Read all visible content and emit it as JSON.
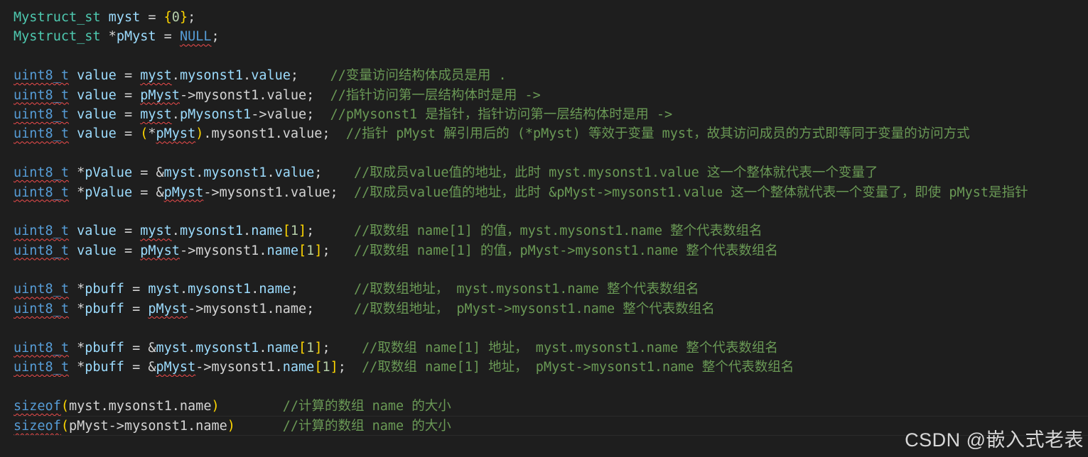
{
  "editor": {
    "lines": [
      [
        {
          "t": "Mystruct_st",
          "c": "t-type"
        },
        {
          "t": " "
        },
        {
          "t": "myst",
          "c": "t-var"
        },
        {
          "t": " = "
        },
        {
          "t": "{",
          "c": "t-brace"
        },
        {
          "t": "0",
          "c": "t-num"
        },
        {
          "t": "}",
          "c": "t-brace"
        },
        {
          "t": ";"
        }
      ],
      [
        {
          "t": "Mystruct_st",
          "c": "t-type"
        },
        {
          "t": " *"
        },
        {
          "t": "pMyst",
          "c": "t-var"
        },
        {
          "t": " = "
        },
        {
          "t": "NULL",
          "c": "t-kw squig"
        },
        {
          "t": ";"
        }
      ],
      [],
      [
        {
          "t": "uint8_t",
          "c": "t-kw squig"
        },
        {
          "t": " "
        },
        {
          "t": "value",
          "c": "t-var"
        },
        {
          "t": " = "
        },
        {
          "t": "myst",
          "c": "t-var squig"
        },
        {
          "t": "."
        },
        {
          "t": "mysonst1",
          "c": "t-var"
        },
        {
          "t": "."
        },
        {
          "t": "value",
          "c": "t-var"
        },
        {
          "t": ";    "
        },
        {
          "t": "//变量访问结构体成员是用 .",
          "c": "t-cmt"
        }
      ],
      [
        {
          "t": "uint8_t",
          "c": "t-kw squig"
        },
        {
          "t": " "
        },
        {
          "t": "value",
          "c": "t-var"
        },
        {
          "t": " = "
        },
        {
          "t": "pMyst",
          "c": "t-var squig"
        },
        {
          "t": "->mysonst1.value;  "
        },
        {
          "t": "//指针访问第一层结构体时是用 ->",
          "c": "t-cmt"
        }
      ],
      [
        {
          "t": "uint8_t",
          "c": "t-kw squig"
        },
        {
          "t": " "
        },
        {
          "t": "value",
          "c": "t-var"
        },
        {
          "t": " = "
        },
        {
          "t": "myst",
          "c": "t-var squig"
        },
        {
          "t": "."
        },
        {
          "t": "pMysonst1",
          "c": "t-var"
        },
        {
          "t": "->value;  "
        },
        {
          "t": "//pMysonst1 是指针，指针访问第一层结构体时是用 ->",
          "c": "t-cmt"
        }
      ],
      [
        {
          "t": "uint8_t",
          "c": "t-kw squig"
        },
        {
          "t": " "
        },
        {
          "t": "value",
          "c": "t-var"
        },
        {
          "t": " = "
        },
        {
          "t": "(",
          "c": "t-brace"
        },
        {
          "t": "*"
        },
        {
          "t": "pMyst",
          "c": "t-var squig"
        },
        {
          "t": ")",
          "c": "t-brace"
        },
        {
          "t": ".mysonst1.value;  "
        },
        {
          "t": "//指针 pMyst 解引用后的 (*pMyst) 等效于变量 myst，故其访问成员的方式即等同于变量的访问方式",
          "c": "t-cmt"
        }
      ],
      [],
      [
        {
          "t": "uint8_t",
          "c": "t-kw squig"
        },
        {
          "t": " *"
        },
        {
          "t": "pValue",
          "c": "t-var"
        },
        {
          "t": " = &"
        },
        {
          "t": "myst",
          "c": "t-var"
        },
        {
          "t": "."
        },
        {
          "t": "mysonst1",
          "c": "t-var"
        },
        {
          "t": "."
        },
        {
          "t": "value",
          "c": "t-var"
        },
        {
          "t": ";    "
        },
        {
          "t": "//取成员value值的地址，此时 myst.mysonst1.value 这一个整体就代表一个变量了",
          "c": "t-cmt"
        }
      ],
      [
        {
          "t": "uint8_t",
          "c": "t-kw squig"
        },
        {
          "t": " *"
        },
        {
          "t": "pValue",
          "c": "t-var"
        },
        {
          "t": " = &"
        },
        {
          "t": "pMyst",
          "c": "t-var squig"
        },
        {
          "t": "->mysonst1.value;  "
        },
        {
          "t": "//取成员value值的地址，此时 &pMyst->mysonst1.value 这一个整体就代表一个变量了，即使 pMyst是指针",
          "c": "t-cmt"
        }
      ],
      [],
      [
        {
          "t": "uint8_t",
          "c": "t-kw squig"
        },
        {
          "t": " "
        },
        {
          "t": "value",
          "c": "t-var"
        },
        {
          "t": " = "
        },
        {
          "t": "myst",
          "c": "t-var squig"
        },
        {
          "t": "."
        },
        {
          "t": "mysonst1",
          "c": "t-var"
        },
        {
          "t": "."
        },
        {
          "t": "name",
          "c": "t-var"
        },
        {
          "t": "[",
          "c": "t-brace"
        },
        {
          "t": "1",
          "c": "t-num"
        },
        {
          "t": "]",
          "c": "t-brace"
        },
        {
          "t": ";     "
        },
        {
          "t": "//取数组 name[1] 的值，myst.mysonst1.name 整个代表数组名",
          "c": "t-cmt"
        }
      ],
      [
        {
          "t": "uint8_t",
          "c": "t-kw squig"
        },
        {
          "t": " "
        },
        {
          "t": "value",
          "c": "t-var"
        },
        {
          "t": " = "
        },
        {
          "t": "pMyst",
          "c": "t-var squig"
        },
        {
          "t": "->mysonst1."
        },
        {
          "t": "name",
          "c": "t-var"
        },
        {
          "t": "[",
          "c": "t-brace"
        },
        {
          "t": "1",
          "c": "t-num"
        },
        {
          "t": "]",
          "c": "t-brace"
        },
        {
          "t": ";   "
        },
        {
          "t": "//取数组 name[1] 的值，pMyst->mysonst1.name 整个代表数组名",
          "c": "t-cmt"
        }
      ],
      [],
      [
        {
          "t": "uint8_t",
          "c": "t-kw squig"
        },
        {
          "t": " *"
        },
        {
          "t": "pbuff",
          "c": "t-var"
        },
        {
          "t": " = "
        },
        {
          "t": "myst",
          "c": "t-var"
        },
        {
          "t": "."
        },
        {
          "t": "mysonst1",
          "c": "t-var"
        },
        {
          "t": "."
        },
        {
          "t": "name",
          "c": "t-var"
        },
        {
          "t": ";       "
        },
        {
          "t": "//取数组地址， myst.mysonst1.name 整个代表数组名",
          "c": "t-cmt"
        }
      ],
      [
        {
          "t": "uint8_t",
          "c": "t-kw squig"
        },
        {
          "t": " *"
        },
        {
          "t": "pbuff",
          "c": "t-var"
        },
        {
          "t": " = "
        },
        {
          "t": "pMyst",
          "c": "t-var squig"
        },
        {
          "t": "->mysonst1.name;     "
        },
        {
          "t": "//取数组地址， pMyst->mysonst1.name 整个代表数组名",
          "c": "t-cmt"
        }
      ],
      [],
      [
        {
          "t": "uint8_t",
          "c": "t-kw squig"
        },
        {
          "t": " *"
        },
        {
          "t": "pbuff",
          "c": "t-var"
        },
        {
          "t": " = &"
        },
        {
          "t": "myst",
          "c": "t-var"
        },
        {
          "t": "."
        },
        {
          "t": "mysonst1",
          "c": "t-var"
        },
        {
          "t": "."
        },
        {
          "t": "name",
          "c": "t-var"
        },
        {
          "t": "[",
          "c": "t-brace"
        },
        {
          "t": "1",
          "c": "t-num"
        },
        {
          "t": "]",
          "c": "t-brace"
        },
        {
          "t": ";    "
        },
        {
          "t": "//取数组 name[1] 地址， myst.mysonst1.name 整个代表数组名",
          "c": "t-cmt"
        }
      ],
      [
        {
          "t": "uint8_t",
          "c": "t-kw squig"
        },
        {
          "t": " *"
        },
        {
          "t": "pbuff",
          "c": "t-var"
        },
        {
          "t": " = &"
        },
        {
          "t": "pMyst",
          "c": "t-var squig"
        },
        {
          "t": "->mysonst1."
        },
        {
          "t": "name",
          "c": "t-var"
        },
        {
          "t": "[",
          "c": "t-brace"
        },
        {
          "t": "1",
          "c": "t-num"
        },
        {
          "t": "]",
          "c": "t-brace"
        },
        {
          "t": ";  "
        },
        {
          "t": "//取数组 name[1] 地址， pMyst->mysonst1.name 整个代表数组名",
          "c": "t-cmt"
        }
      ],
      [],
      [
        {
          "t": "sizeof",
          "c": "t-kw squig"
        },
        {
          "t": "(",
          "c": "t-brace"
        },
        {
          "t": "myst.mysonst1.name"
        },
        {
          "t": ")",
          "c": "t-brace"
        },
        {
          "t": "        "
        },
        {
          "t": "//计算的数组 name 的大小",
          "c": "t-cmt"
        }
      ],
      [
        {
          "t": "sizeof",
          "c": "t-kw squig"
        },
        {
          "t": "(",
          "c": "t-brace"
        },
        {
          "t": "pMyst->mysonst1.name"
        },
        {
          "t": ")",
          "c": "t-brace"
        },
        {
          "t": "      "
        },
        {
          "t": "//计算的数组 name 的大小",
          "c": "t-cmt"
        }
      ]
    ],
    "current_line": 21
  },
  "watermark": "CSDN @嵌入式老表"
}
